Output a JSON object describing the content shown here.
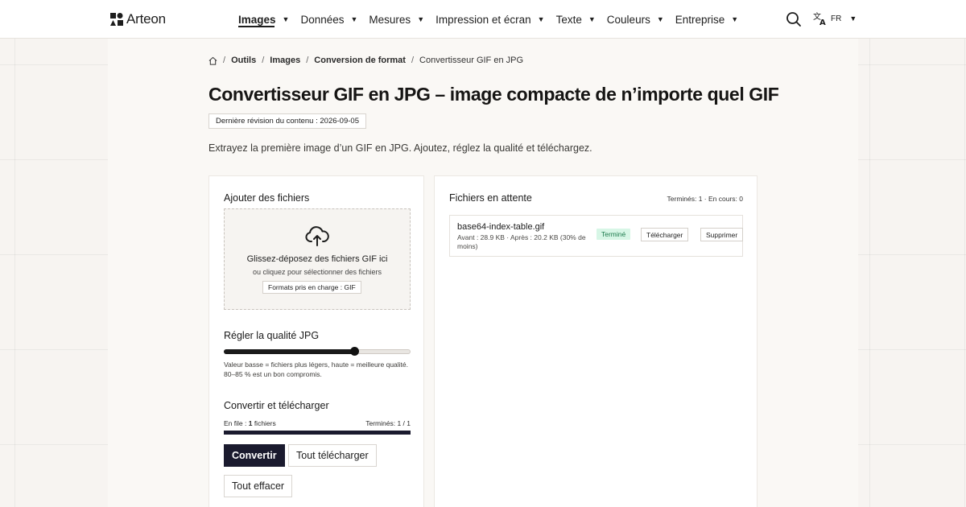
{
  "header": {
    "brand": "Arteon",
    "nav": [
      {
        "label": "Images",
        "active": true
      },
      {
        "label": "Données",
        "active": false
      },
      {
        "label": "Mesures",
        "active": false
      },
      {
        "label": "Impression et écran",
        "active": false
      },
      {
        "label": "Texte",
        "active": false
      },
      {
        "label": "Couleurs",
        "active": false
      },
      {
        "label": "Entreprise",
        "active": false
      }
    ],
    "search_icon": "search-icon",
    "language_icon": "translate-icon",
    "language_code": "FR"
  },
  "breadcrumb": {
    "home_icon": "home-icon",
    "items": [
      "Outils",
      "Images",
      "Conversion de format"
    ],
    "current": "Convertisseur GIF en JPG"
  },
  "page": {
    "title": "Convertisseur GIF en JPG – image compacte de n’importe quel GIF",
    "revision": "Dernière révision du contenu : 2026-09-05",
    "subtitle": "Extrayez la première image d’un GIF en JPG. Ajoutez, réglez la qualité et téléchargez."
  },
  "upload": {
    "title": "Ajouter des fichiers",
    "icon": "cloud-upload-icon",
    "drop_text": "Glissez-déposez des fichiers GIF ici",
    "click_text": "ou cliquez pour sélectionner des fichiers",
    "formats": "Formats pris en charge : GIF"
  },
  "quality": {
    "title": "Régler la qualité JPG",
    "value_fraction": 0.7,
    "hint": "Valeur basse = fichiers plus légers, haute = meilleure qualité. 80–85 % est un bon compromis."
  },
  "convert": {
    "title": "Convertir et télécharger",
    "queue_prefix": "En file : ",
    "queue_count": "1",
    "queue_suffix": " fichiers",
    "done_label": "Terminés: 1 / 1",
    "progress_fraction": 1.0,
    "convert_button": "Convertir",
    "download_all_button": "Tout télécharger",
    "clear_all_button": "Tout effacer"
  },
  "pending": {
    "title": "Fichiers en attente",
    "counts": "Terminés: 1 · En cours: 0",
    "files": [
      {
        "name": "base64-index-table.gif",
        "sizes": "Avant : 28.9 KB · Après : 20.2 KB (30% de moins)",
        "status": "Terminé",
        "download": "Télécharger",
        "delete": "Supprimer"
      }
    ]
  },
  "colors": {
    "primary": "#1a1a2e",
    "success_text": "#1d7a4c",
    "success_bg": "#d7f6e6",
    "page_bg": "#f7f4f1"
  }
}
